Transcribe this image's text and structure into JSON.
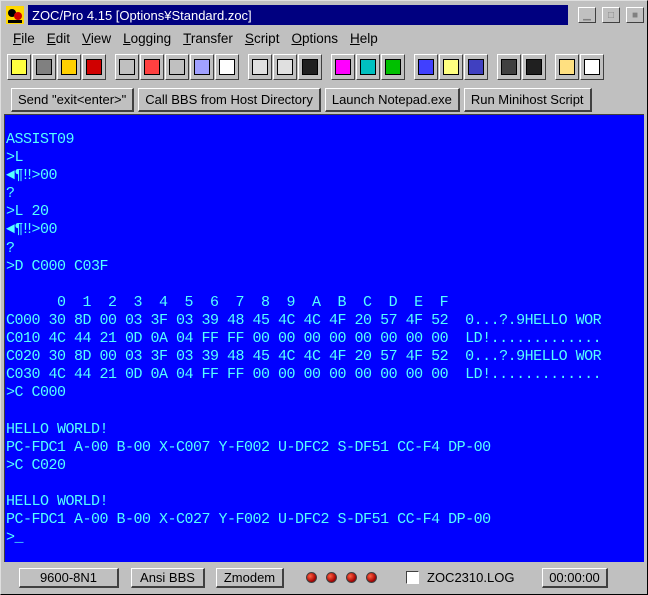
{
  "window": {
    "title": "ZOC/Pro 4.15 [Options¥Standard.zoc]"
  },
  "menu": [
    {
      "label": "File",
      "u": "F",
      "rest": "ile"
    },
    {
      "label": "Edit",
      "u": "E",
      "rest": "dit"
    },
    {
      "label": "View",
      "u": "V",
      "rest": "iew"
    },
    {
      "label": "Logging",
      "u": "L",
      "rest": "ogging"
    },
    {
      "label": "Transfer",
      "u": "T",
      "rest": "ransfer"
    },
    {
      "label": "Script",
      "u": "S",
      "rest": "cript"
    },
    {
      "label": "Options",
      "u": "O",
      "rest": "ptions"
    },
    {
      "label": "Help",
      "u": "H",
      "rest": "elp"
    }
  ],
  "toolbar": {
    "icons": [
      "notepad-icon",
      "address-book-icon",
      "save-session-icon",
      "alert-icon",
      "find-icon",
      "clear-icon",
      "search-icon",
      "print-icon",
      "copy-icon",
      "upload-icon",
      "download-icon",
      "terminal-icon",
      "disk-send-icon",
      "disk-receive-icon",
      "abort-transfer-icon",
      "host-directory-icon",
      "edit-icon",
      "run-icon",
      "printer-icon",
      "terminal-window-icon",
      "edit-script-icon",
      "options-icon"
    ]
  },
  "buttons": [
    "Send \"exit<enter>\"",
    "Call BBS from Host Directory",
    "Launch Notepad.exe",
    "Run Minihost Script"
  ],
  "terminal": {
    "lines": [
      "ASSIST09",
      ">L",
      "◄¶‼>00",
      "?",
      ">L 20",
      "◄¶‼>00",
      "?",
      ">D C000 C03F",
      "",
      "      0  1  2  3  4  5  6  7  8  9  A  B  C  D  E  F",
      "C000 30 8D 00 03 3F 03 39 48 45 4C 4C 4F 20 57 4F 52  0...?.9HELLO WOR",
      "C010 4C 44 21 0D 0A 04 FF FF 00 00 00 00 00 00 00 00  LD!.............",
      "C020 30 8D 00 03 3F 03 39 48 45 4C 4C 4F 20 57 4F 52  0...?.9HELLO WOR",
      "C030 4C 44 21 0D 0A 04 FF FF 00 00 00 00 00 00 00 00  LD!.............",
      ">C C000",
      "",
      "HELLO WORLD!",
      "PC-FDC1 A-00 B-00 X-C007 Y-F002 U-DFC2 S-DF51 CC-F4 DP-00",
      ">C C020",
      "",
      "HELLO WORLD!",
      "PC-FDC1 A-00 B-00 X-C027 Y-F002 U-DFC2 S-DF51 CC-F4 DP-00",
      ">_"
    ],
    "fg_color": "#55ffff",
    "bg_color": "#0000ff"
  },
  "status": {
    "baud": "9600-8N1",
    "emulation": "Ansi BBS",
    "protocol": "Zmodem",
    "log_file": "ZOC2310.LOG",
    "timer": "00:00:00"
  }
}
